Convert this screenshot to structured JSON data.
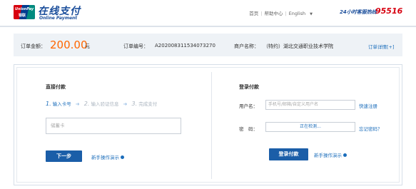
{
  "header": {
    "logo_badge_top": "UnionPay",
    "logo_badge_bottom": "银联",
    "logo_title": "在线支付",
    "logo_subtitle": "Online Payment",
    "nav": [
      "首页",
      "帮助中心",
      "English"
    ],
    "hotline_label": "24小时客服热线",
    "hotline_number": "95516"
  },
  "order": {
    "amount_label": "订单金额：",
    "amount": "200.00",
    "currency": "元",
    "number_label": "订单编号：",
    "number": "A202008311534073270",
    "merchant_label": "商户名称：",
    "merchant": "（特约）湖北交通职业技术学院",
    "detail_link": "订单详情[+]"
  },
  "direct_pay": {
    "title": "直接付款",
    "steps": [
      {
        "num": "1.",
        "label": "输入卡号",
        "active": true
      },
      {
        "num": "2.",
        "label": "输入验证信息",
        "active": false
      },
      {
        "num": "3.",
        "label": "完成支付",
        "active": false
      }
    ],
    "card_placeholder": "储蓄卡",
    "next_button": "下一步",
    "demo_link": "新手操作演示"
  },
  "login_pay": {
    "title": "登录付款",
    "username_label": "用户名：",
    "username_placeholder": "手机号/邮箱/自定义用户名",
    "register_link": "快速注册",
    "password_label": "密　码：",
    "password_status": "正在检测...",
    "forgot_link": "忘记密码？",
    "login_button": "登录付款",
    "demo_link": "新手操作演示"
  },
  "colors": {
    "brand_blue": "#1b4e9b",
    "accent_orange": "#ff6600",
    "button_blue": "#1b5ea8",
    "hotline_red": "#d7000f"
  }
}
